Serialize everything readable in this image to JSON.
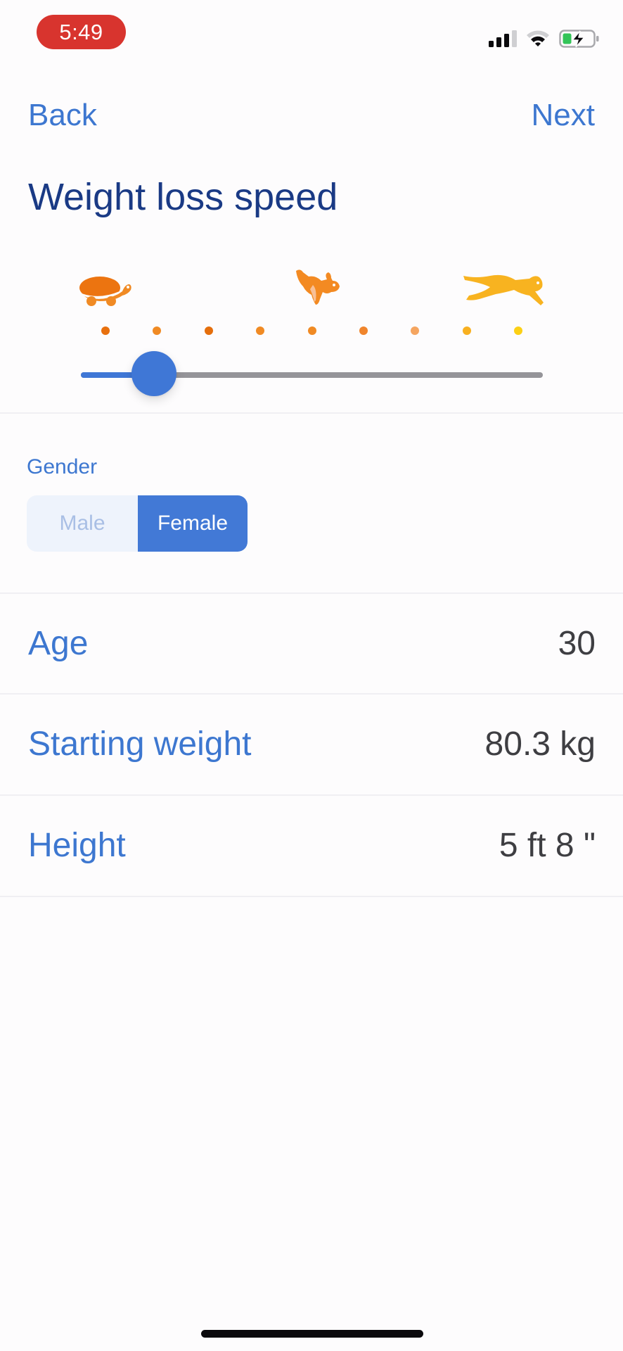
{
  "status_bar": {
    "time": "5:49",
    "signal_icon": "cellular-signal-icon",
    "wifi_icon": "wifi-icon",
    "battery_icon": "battery-charging-icon",
    "pill_color": "#D8342E"
  },
  "nav": {
    "back_label": "Back",
    "next_label": "Next"
  },
  "page": {
    "title": "Weight loss speed"
  },
  "speed_slider": {
    "icons": [
      {
        "name": "turtle-icon",
        "meaning": "slow",
        "color": "#EC7410"
      },
      {
        "name": "rabbit-icon",
        "meaning": "medium",
        "color": "#F38A22"
      },
      {
        "name": "cheetah-icon",
        "meaning": "fast",
        "color": "#F8B320"
      }
    ],
    "step_count": 9,
    "current_step": 2,
    "tick_colors": [
      "#E8700E",
      "#F08A24",
      "#E56E0C",
      "#F08A24",
      "#F08A24",
      "#F0852C",
      "#F5A560",
      "#F8B020",
      "#FCD015"
    ],
    "active_color": "#3F77D6",
    "inactive_color": "#959499"
  },
  "gender": {
    "label": "Gender",
    "options": [
      "Male",
      "Female"
    ],
    "selected": "Female"
  },
  "rows": [
    {
      "label": "Age",
      "value": "30"
    },
    {
      "label": "Starting weight",
      "value": "80.3 kg"
    },
    {
      "label": "Height",
      "value": "5 ft 8 \""
    }
  ],
  "colors": {
    "accent": "#3D77D0",
    "title": "#1A3A85",
    "value_text": "#3E3E42",
    "background": "#FDFCFD"
  }
}
